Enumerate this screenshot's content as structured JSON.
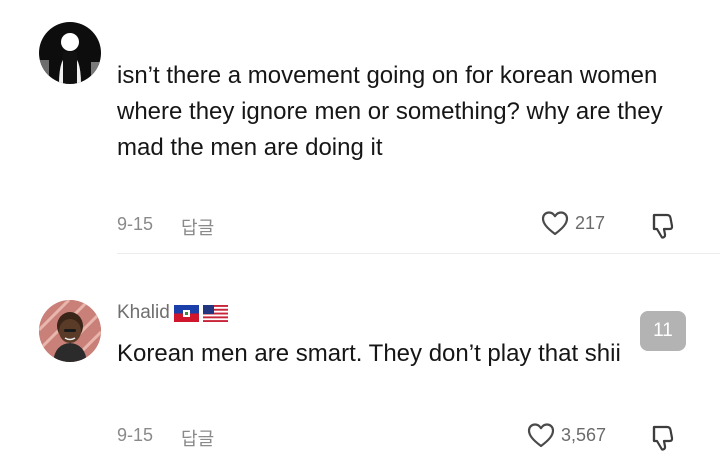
{
  "comments": [
    {
      "username": "",
      "text": "isn’t there a movement going on for korean women where they ignore men or something? why are they mad the men are doing it",
      "date": "9-15",
      "reply_label": "답글",
      "likes": "217",
      "icons": {
        "like": "heart-outline-icon",
        "dislike": "thumbs-down-icon"
      }
    },
    {
      "username": "Khalid",
      "flags": [
        "haiti-flag-icon",
        "us-flag-icon"
      ],
      "text": "Korean men are smart. They don’t play that shii",
      "date": "9-15",
      "reply_label": "답글",
      "likes": "3,567",
      "icons": {
        "like": "heart-outline-icon",
        "dislike": "thumbs-down-icon"
      }
    }
  ],
  "overlay_badge": "11",
  "colors": {
    "text": "#161616",
    "muted": "#8a8a8a",
    "divider": "#ececec",
    "badge_bg": "#b3b3b3"
  }
}
